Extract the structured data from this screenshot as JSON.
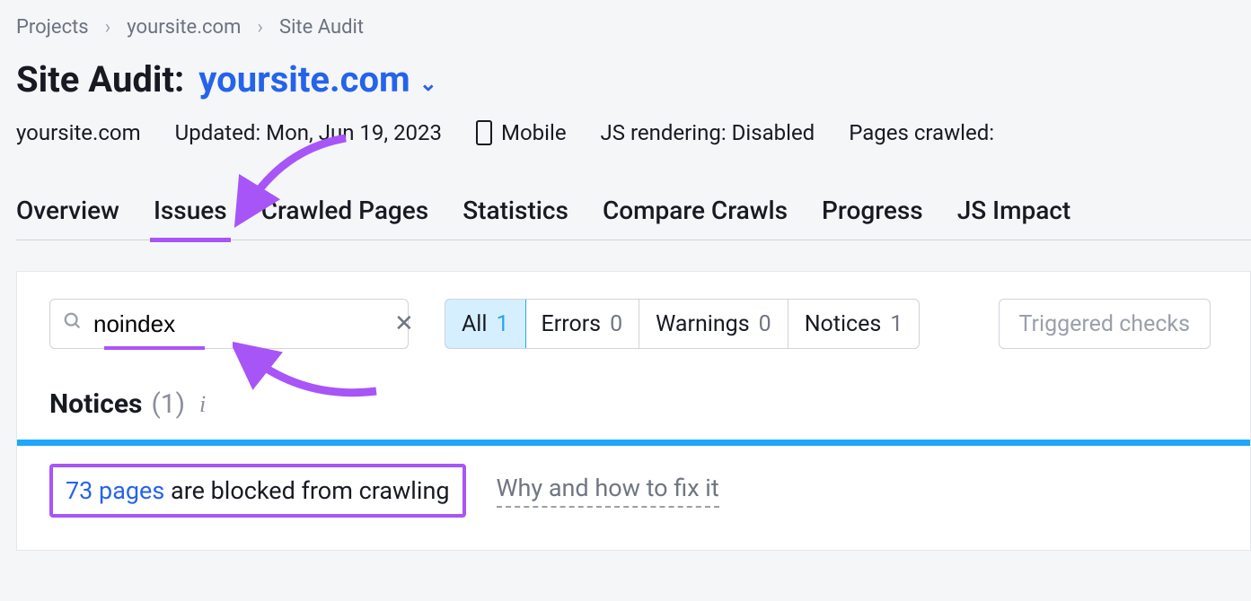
{
  "breadcrumbs": {
    "items": [
      "Projects",
      "yoursite.com",
      "Site Audit"
    ]
  },
  "title": {
    "prefix": "Site Audit:",
    "domain": "yoursite.com"
  },
  "meta": {
    "domain": "yoursite.com",
    "updated": "Updated: Mon, Jun 19, 2023",
    "device": "Mobile",
    "js_rendering": "JS rendering: Disabled",
    "pages_crawled_label": "Pages crawled:"
  },
  "tabs": {
    "items": [
      "Overview",
      "Issues",
      "Crawled Pages",
      "Statistics",
      "Compare Crawls",
      "Progress",
      "JS Impact"
    ],
    "active": "Issues"
  },
  "search": {
    "value": "noindex"
  },
  "segments": {
    "all_label": "All",
    "all_count": "1",
    "errors_label": "Errors",
    "errors_count": "0",
    "warnings_label": "Warnings",
    "warnings_count": "0",
    "notices_label": "Notices",
    "notices_count": "1"
  },
  "trigger_button": "Triggered checks",
  "notices_section": {
    "label": "Notices",
    "count": "(1)"
  },
  "result": {
    "count_text": "73 pages",
    "rest": " are blocked from crawling",
    "howfix": "Why and how to fix it"
  }
}
